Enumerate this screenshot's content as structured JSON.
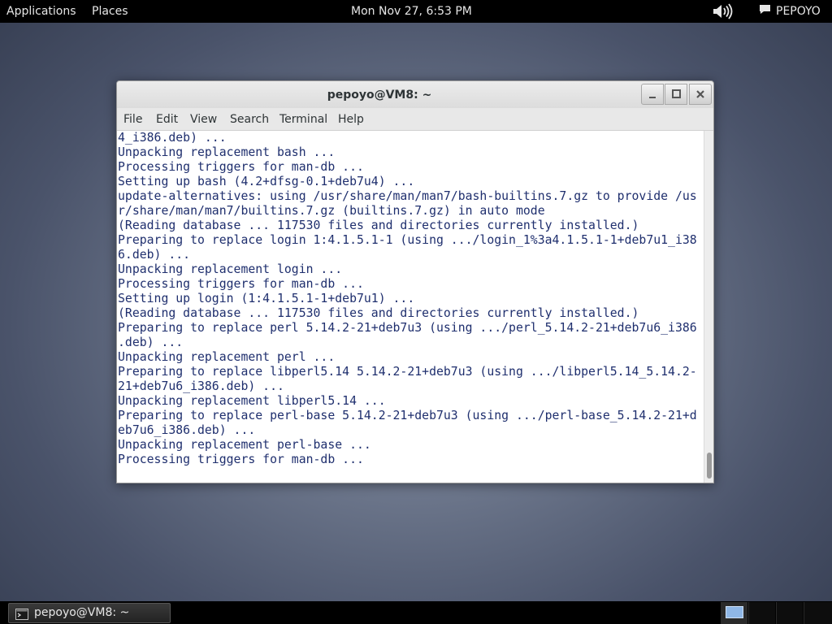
{
  "top_panel": {
    "applications": "Applications",
    "places": "Places",
    "clock": "Mon Nov 27,  6:53 PM",
    "user": "PEPOYO"
  },
  "window": {
    "title": "pepoyo@VM8: ~",
    "menu": [
      "File",
      "Edit",
      "View",
      "Search",
      "Terminal",
      "Help"
    ]
  },
  "terminal": {
    "lines": [
      "4_i386.deb) ...",
      "Unpacking replacement bash ...",
      "Processing triggers for man-db ...",
      "Setting up bash (4.2+dfsg-0.1+deb7u4) ...",
      "update-alternatives: using /usr/share/man/man7/bash-builtins.7.gz to provide /us",
      "r/share/man/man7/builtins.7.gz (builtins.7.gz) in auto mode",
      "(Reading database ... 117530 files and directories currently installed.)",
      "Preparing to replace login 1:4.1.5.1-1 (using .../login_1%3a4.1.5.1-1+deb7u1_i38",
      "6.deb) ...",
      "Unpacking replacement login ...",
      "Processing triggers for man-db ...",
      "Setting up login (1:4.1.5.1-1+deb7u1) ...",
      "(Reading database ... 117530 files and directories currently installed.)",
      "Preparing to replace perl 5.14.2-21+deb7u3 (using .../perl_5.14.2-21+deb7u6_i386",
      ".deb) ...",
      "Unpacking replacement perl ...",
      "Preparing to replace libperl5.14 5.14.2-21+deb7u3 (using .../libperl5.14_5.14.2-",
      "21+deb7u6_i386.deb) ...",
      "Unpacking replacement libperl5.14 ...",
      "Preparing to replace perl-base 5.14.2-21+deb7u3 (using .../perl-base_5.14.2-21+d",
      "eb7u6_i386.deb) ...",
      "Unpacking replacement perl-base ...",
      "Processing triggers for man-db ..."
    ]
  },
  "taskbar": {
    "window_label": "pepoyo@VM8: ~"
  },
  "icons": {
    "volume": "volume-icon",
    "chat": "chat-icon",
    "minimize": "minimize-icon",
    "maximize": "maximize-icon",
    "close": "close-icon",
    "terminal": "terminal-icon"
  }
}
